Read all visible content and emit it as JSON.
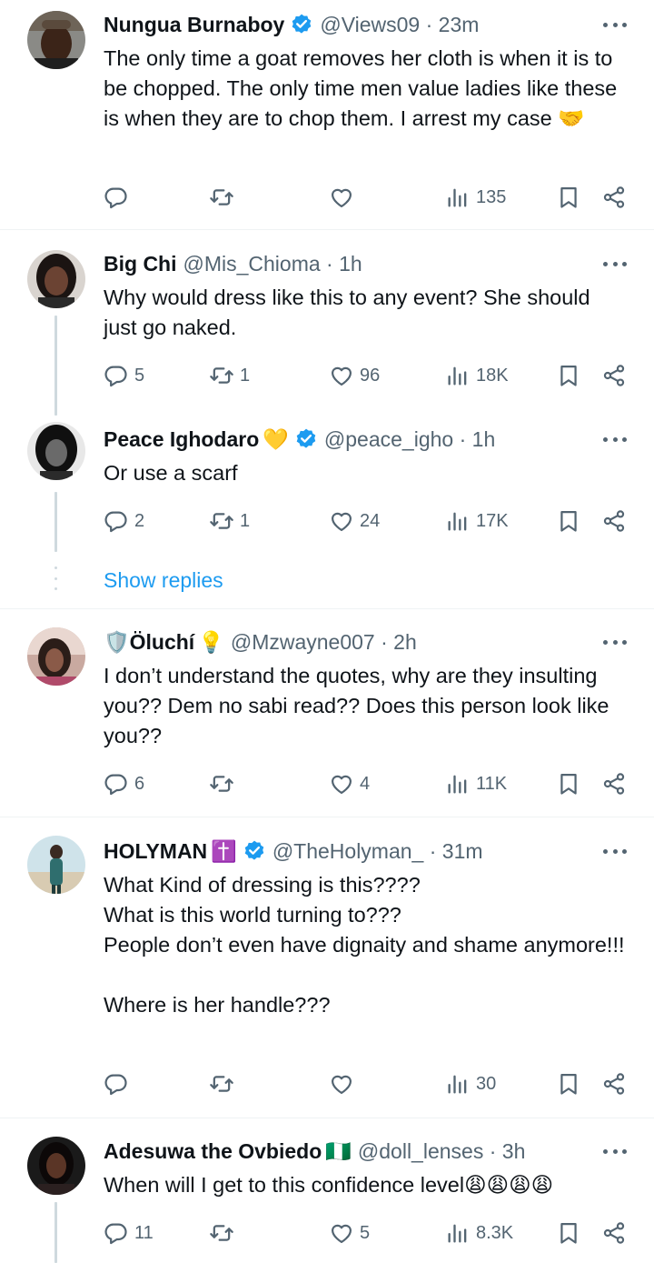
{
  "colors": {
    "accent": "#1d9bf0",
    "muted": "#536471",
    "text": "#0f1419",
    "separator": "#eff3f4"
  },
  "show_replies_label": "Show replies",
  "tweets": [
    {
      "name": "Nungua Burnaboy",
      "name_emoji": "",
      "verified": true,
      "handle_time": "@Views09 · 23m",
      "text": "The only time a goat removes her cloth is when it is to be chopped. The only time men value ladies like these is when they are to chop them. I arrest my case 🤝",
      "replies": "",
      "retweets": "",
      "likes": "",
      "views": "135"
    },
    {
      "name": "Big Chi",
      "name_emoji": "",
      "verified": false,
      "handle_time": "@Mis_Chioma · 1h",
      "text": "Why would dress like this to any event? She should just go naked.",
      "replies": "5",
      "retweets": "1",
      "likes": "96",
      "views": "18K"
    },
    {
      "name": "Peace Ighodaro",
      "name_emoji": "💛",
      "verified": true,
      "handle_time": "@peace_igho · 1h",
      "text": "Or use a scarf",
      "replies": "2",
      "retweets": "1",
      "likes": "24",
      "views": "17K"
    },
    {
      "name": "🛡️Öluchí",
      "name_emoji": "💡",
      "verified": false,
      "handle_time": "@Mzwayne007 · 2h",
      "text": "I don’t understand the quotes, why are they insulting you?? Dem no sabi read?? Does this person look like you??",
      "replies": "6",
      "retweets": "",
      "likes": "4",
      "views": "11K"
    },
    {
      "name": "HOLYMAN",
      "name_emoji": "✝️",
      "verified": true,
      "handle_time": "@TheHolyman_ · 31m",
      "text": "What Kind of dressing is this????\nWhat is this world turning to???\nPeople don’t even have dignaity and shame anymore!!!\n\nWhere is her handle???",
      "replies": "",
      "retweets": "",
      "likes": "",
      "views": "30"
    },
    {
      "name": "Adesuwa the Ovbiedo",
      "name_emoji": "🇳🇬",
      "verified": false,
      "handle_time": "@doll_lenses · 3h",
      "text": "When will I get to this confidence level😩😩😩😩",
      "replies": "11",
      "retweets": "",
      "likes": "5",
      "views": "8.3K"
    }
  ]
}
